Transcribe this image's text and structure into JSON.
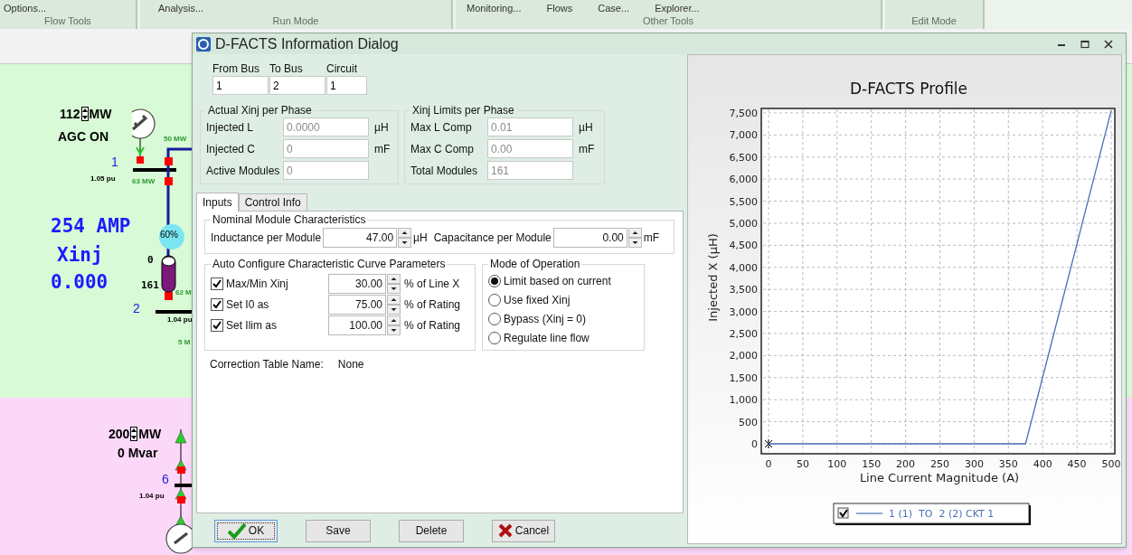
{
  "ribbon": {
    "groups": [
      {
        "label": "Flow Tools",
        "commands": [
          "Options..."
        ]
      },
      {
        "label": "Run Mode",
        "commands": [
          "Analysis..."
        ]
      },
      {
        "label": "Other Tools",
        "commands": [
          "Monitoring...",
          "Flows",
          "Case...",
          "Explorer..."
        ]
      },
      {
        "label": "Edit Mode"
      }
    ]
  },
  "diagram": {
    "labels": [
      {
        "kind": "gen",
        "text": "112",
        "unit": "MW"
      },
      {
        "kind": "status",
        "text": "AGC ON"
      },
      {
        "kind": "bus",
        "text": "1"
      },
      {
        "kind": "pu",
        "text": "1.05 pu"
      },
      {
        "kind": "flow",
        "text": "50 MW"
      },
      {
        "kind": "flow",
        "text": "63 MW"
      },
      {
        "kind": "big",
        "text": "254 AMP"
      },
      {
        "kind": "big",
        "text": "Xinj"
      },
      {
        "kind": "big",
        "text": "0.000"
      },
      {
        "kind": "pct",
        "text": "60%"
      },
      {
        "kind": "tap",
        "text": "0"
      },
      {
        "kind": "tap",
        "text": "161"
      },
      {
        "kind": "flow",
        "text": "62 M"
      },
      {
        "kind": "bus",
        "text": "2"
      },
      {
        "kind": "pu",
        "text": "1.04 pu"
      },
      {
        "kind": "flow",
        "text": "5 M"
      },
      {
        "kind": "gen",
        "text": "200",
        "unit": "MW"
      },
      {
        "kind": "status",
        "text": "0 Mvar"
      },
      {
        "kind": "bus",
        "text": "6"
      },
      {
        "kind": "pu",
        "text": "1.04 pu"
      }
    ]
  },
  "dialog": {
    "title": "D-FACTS Information Dialog",
    "branch": [
      {
        "label": "From Bus",
        "value": "1"
      },
      {
        "label": "To Bus",
        "value": "2"
      },
      {
        "label": "Circuit",
        "value": "1"
      }
    ],
    "actual": {
      "title": "Actual Xinj per Phase",
      "disabled": true,
      "rows": [
        {
          "label": "Injected L",
          "value": "0.0000",
          "unit": "µH"
        },
        {
          "label": "Injected C",
          "value": "0",
          "unit": "mF"
        },
        {
          "label": "Active Modules",
          "value": "0"
        }
      ]
    },
    "limits": {
      "title": "Xinj Limits per Phase",
      "disabled": true,
      "rows": [
        {
          "label": "Max L Comp",
          "value": "0.01",
          "unit": "µH"
        },
        {
          "label": "Max C Comp",
          "value": "0.00",
          "unit": "mF"
        },
        {
          "label": "Total Modules",
          "value": "161"
        }
      ]
    },
    "tabs": [
      {
        "label": "Inputs",
        "selected": true
      },
      {
        "label": "Control Info",
        "selected": false
      }
    ],
    "nominal": {
      "title": "Nominal Module Characteristics",
      "fields": [
        {
          "label": "Inductance per Module",
          "value": "47.00",
          "unit": "µH"
        },
        {
          "label": "Capacitance per Module",
          "value": "0.00",
          "unit": "mF"
        }
      ]
    },
    "auto": {
      "title": "Auto Configure Characteristic Curve Parameters",
      "rows": [
        {
          "label": "Max/Min Xinj",
          "checked": true,
          "value": "30.00",
          "unit": "% of Line X"
        },
        {
          "label": "Set I0 as",
          "checked": true,
          "value": "75.00",
          "unit": "% of Rating"
        },
        {
          "label": "Set Ilim as",
          "checked": true,
          "value": "100.00",
          "unit": "% of Rating"
        }
      ]
    },
    "mode": {
      "title": "Mode of Operation",
      "options": [
        {
          "label": "Limit based on current",
          "selected": true
        },
        {
          "label": "Use fixed Xinj",
          "selected": false
        },
        {
          "label": "Bypass (Xinj = 0)",
          "selected": false
        },
        {
          "label": "Regulate line flow",
          "selected": false
        }
      ]
    },
    "correction": {
      "label": "Correction Table Name:",
      "value": "None"
    },
    "buttons": [
      {
        "kind": "ok",
        "label": "OK"
      },
      {
        "kind": "plain",
        "label": "Save"
      },
      {
        "kind": "plain",
        "label": "Delete"
      },
      {
        "kind": "cancel",
        "label": "Cancel"
      }
    ],
    "chart": {
      "legend_checked": true,
      "chart_data": {
        "type": "line",
        "title": "D-FACTS Profile",
        "xlabel": "Line Current Magnitude (A)",
        "ylabel": "Injected X (µH)",
        "x": [
          0,
          375,
          500
        ],
        "series": [
          {
            "name": "1 (1)  TO  2 (2) CKT 1",
            "color": "#4a6fb5",
            "values": [
              0,
              0,
              7550
            ]
          }
        ],
        "xlim": [
          0,
          500
        ],
        "ylim": [
          0,
          7600
        ],
        "grid": true,
        "xticks": [
          0,
          50,
          100,
          150,
          200,
          250,
          300,
          350,
          400,
          450,
          500
        ],
        "yticks": [
          {
            "value": 0,
            "label": "0"
          },
          {
            "value": 500,
            "label": "500"
          },
          {
            "value": 1000,
            "label": "1,000"
          },
          {
            "value": 1500,
            "label": "1,500"
          },
          {
            "value": 2000,
            "label": "2,000"
          },
          {
            "value": 2500,
            "label": "2,500"
          },
          {
            "value": 3000,
            "label": "3,000"
          },
          {
            "value": 3500,
            "label": "3,500"
          },
          {
            "value": 4000,
            "label": "4,000"
          },
          {
            "value": 4500,
            "label": "4,500"
          },
          {
            "value": 5000,
            "label": "5,000"
          },
          {
            "value": 5500,
            "label": "5,500"
          },
          {
            "value": 6000,
            "label": "6,000"
          },
          {
            "value": 6500,
            "label": "6,500"
          },
          {
            "value": 7000,
            "label": "7,000"
          },
          {
            "value": 7500,
            "label": "7,500"
          }
        ]
      }
    }
  }
}
